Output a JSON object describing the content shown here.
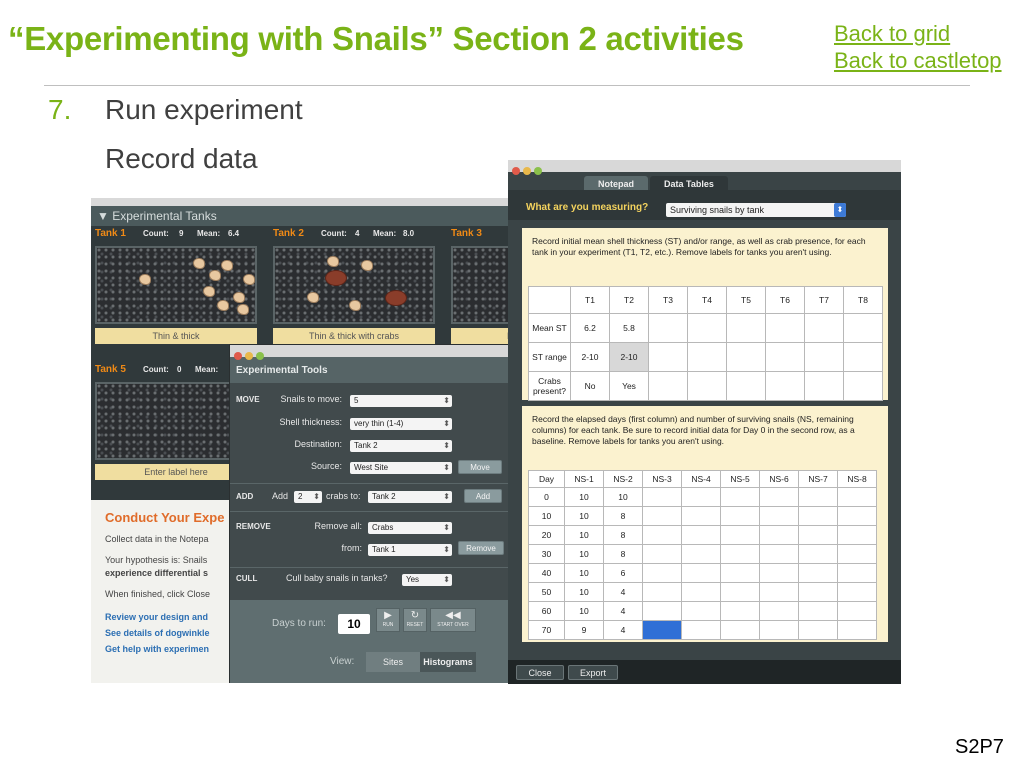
{
  "slide": {
    "title": "“Experimenting with Snails” Section 2 activities",
    "links": [
      "Back to grid",
      "Back to castletop"
    ],
    "step_number": "7.",
    "step_text": "Run experiment",
    "step_sub": "Record data",
    "code": "S2P7",
    "accent_color": "#7ab317"
  },
  "tanks_window": {
    "header": "▼ Experimental Tanks",
    "tanks": [
      {
        "name": "Tank 1",
        "count_label": "Count:",
        "count": "9",
        "mean_label": "Mean:",
        "mean": "6.4",
        "label": "Thin & thick"
      },
      {
        "name": "Tank 2",
        "count_label": "Count:",
        "count": "4",
        "mean_label": "Mean:",
        "mean": "8.0",
        "label": "Thin & thick with crabs"
      },
      {
        "name": "Tank 3",
        "count_label": "",
        "count": "",
        "mean_label": "",
        "mean": "",
        "label": "E"
      },
      {
        "name": "Tank 5",
        "count_label": "Count:",
        "count": "0",
        "mean_label": "Mean:",
        "mean": "",
        "label": "Enter label here"
      }
    ],
    "conduct": {
      "title": "Conduct Your Expe",
      "line1": "Collect data in the Notepa",
      "line2a": "Your hypothesis is: Snails",
      "line2b": "experience differential s",
      "line3": "When finished, click Close",
      "links": [
        "Review your design and",
        "See details of dogwinkle",
        "Get help with experimen"
      ]
    }
  },
  "tools_window": {
    "title": "Experimental Tools",
    "move": {
      "section": "MOVE",
      "snails_label": "Snails to move:",
      "snails_value": "5",
      "shell_label": "Shell thickness:",
      "shell_value": "very thin (1-4)",
      "dest_label": "Destination:",
      "dest_value": "Tank 2",
      "source_label": "Source:",
      "source_value": "West Site",
      "button": "Move"
    },
    "add": {
      "section": "ADD",
      "add_label": "Add",
      "count_value": "2",
      "crabs_to_label": "crabs to:",
      "tank_value": "Tank 2",
      "button": "Add"
    },
    "remove": {
      "section": "REMOVE",
      "remove_all_label": "Remove all:",
      "remove_value": "Crabs",
      "from_label": "from:",
      "from_value": "Tank 1",
      "button": "Remove"
    },
    "cull": {
      "section": "CULL",
      "label": "Cull baby snails in tanks?",
      "value": "Yes"
    },
    "days_label": "Days to run:",
    "days_value": "10",
    "controls": [
      "RUN",
      "RESET",
      "START OVER"
    ],
    "view_label": "View:",
    "view_options": [
      "Sites",
      "Histograms"
    ]
  },
  "data_window": {
    "tabs": [
      "Notepad",
      "Data Tables"
    ],
    "measure_label": "What are you measuring?",
    "measure_value": "Surviving snails by tank",
    "instr1": "Record initial mean shell thickness (ST) and/or range, as well as crab presence, for each tank in your experiment (T1, T2, etc.). Remove labels for tanks you aren't using.",
    "table1": {
      "headers": [
        "",
        "T1",
        "T2",
        "T3",
        "T4",
        "T5",
        "T6",
        "T7",
        "T8"
      ],
      "rows": [
        [
          "Mean ST",
          "6.2",
          "5.8",
          "",
          "",
          "",
          "",
          "",
          ""
        ],
        [
          "ST range",
          "2-10",
          "2-10",
          "",
          "",
          "",
          "",
          "",
          ""
        ],
        [
          "Crabs present?",
          "No",
          "Yes",
          "",
          "",
          "",
          "",
          "",
          ""
        ]
      ]
    },
    "instr2": "Record the elapsed days (first column) and number of surviving snails (NS, remaining columns) for each tank. Be sure to record initial data for Day 0 in the second row, as a baseline. Remove labels for tanks you aren't using.",
    "table2": {
      "headers": [
        "Day",
        "NS-1",
        "NS-2",
        "NS-3",
        "NS-4",
        "NS-5",
        "NS-6",
        "NS-7",
        "NS-8"
      ],
      "rows": [
        [
          "0",
          "10",
          "10",
          "",
          "",
          "",
          "",
          "",
          ""
        ],
        [
          "10",
          "10",
          "8",
          "",
          "",
          "",
          "",
          "",
          ""
        ],
        [
          "20",
          "10",
          "8",
          "",
          "",
          "",
          "",
          "",
          ""
        ],
        [
          "30",
          "10",
          "8",
          "",
          "",
          "",
          "",
          "",
          ""
        ],
        [
          "40",
          "10",
          "6",
          "",
          "",
          "",
          "",
          "",
          ""
        ],
        [
          "50",
          "10",
          "4",
          "",
          "",
          "",
          "",
          "",
          ""
        ],
        [
          "60",
          "10",
          "4",
          "",
          "",
          "",
          "",
          "",
          ""
        ],
        [
          "70",
          "9",
          "4",
          "",
          "",
          "",
          "",
          "",
          ""
        ]
      ]
    },
    "close_button": "Close",
    "export_button": "Export"
  }
}
